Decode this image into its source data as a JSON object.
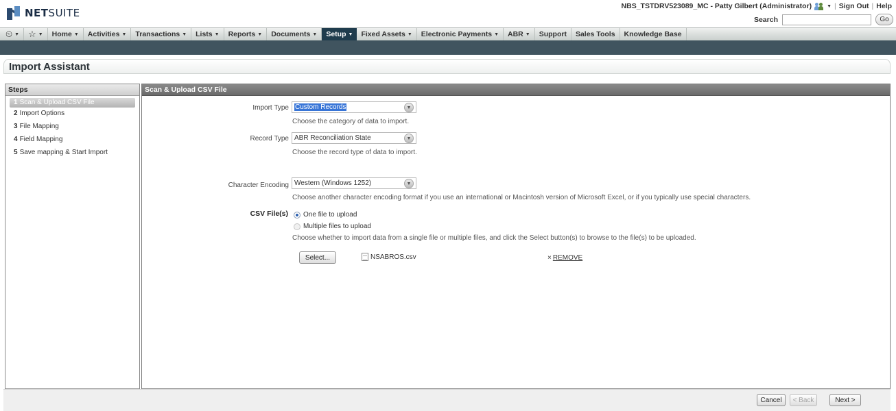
{
  "brand": {
    "prefix": "NET",
    "suffix": "SUITE"
  },
  "account": {
    "name": "NBS_TSTDRV523089_MC - Patty Gilbert (Administrator)",
    "signout": "Sign Out",
    "help": "Help",
    "search_label": "Search",
    "search_value": "",
    "go": "Go"
  },
  "nav": {
    "items": [
      {
        "label": "Home",
        "caret": true
      },
      {
        "label": "Activities",
        "caret": true
      },
      {
        "label": "Transactions",
        "caret": true
      },
      {
        "label": "Lists",
        "caret": true
      },
      {
        "label": "Reports",
        "caret": true
      },
      {
        "label": "Documents",
        "caret": true
      },
      {
        "label": "Setup",
        "caret": true,
        "active": true
      },
      {
        "label": "Fixed Assets",
        "caret": true
      },
      {
        "label": "Electronic Payments",
        "caret": true
      },
      {
        "label": "ABR",
        "caret": true
      },
      {
        "label": "Support",
        "caret": false
      },
      {
        "label": "Sales Tools",
        "caret": false
      },
      {
        "label": "Knowledge Base",
        "caret": false
      }
    ]
  },
  "page": {
    "title": "Import Assistant"
  },
  "steps": {
    "header": "Steps",
    "items": [
      {
        "num": "1",
        "label": "Scan & Upload CSV File"
      },
      {
        "num": "2",
        "label": "Import Options"
      },
      {
        "num": "3",
        "label": "File Mapping"
      },
      {
        "num": "4",
        "label": "Field Mapping"
      },
      {
        "num": "5",
        "label": "Save mapping & Start Import"
      }
    ]
  },
  "form": {
    "header": "Scan & Upload CSV File",
    "import_type": {
      "label": "Import Type",
      "value": "Custom Records",
      "help": "Choose the category of data to import."
    },
    "record_type": {
      "label": "Record Type",
      "value": "ABR Reconciliation State",
      "help": "Choose the record type of data to import."
    },
    "encoding": {
      "label": "Character Encoding",
      "value": "Western (Windows 1252)",
      "help": "Choose another character encoding format if you use an international or Macintosh version of Microsoft Excel, or if you typically use special characters."
    },
    "csv": {
      "label": "CSV File(s)",
      "option_one": "One file to upload",
      "option_multi": "Multiple files to upload",
      "help": "Choose whether to import data from a single file or multiple files, and click the Select button(s) to browse to the file(s) to be uploaded.",
      "select_label": "Select...",
      "file_name": "NSABROS.csv",
      "remove_label": "REMOVE"
    }
  },
  "footer": {
    "cancel": "Cancel",
    "back": "< Back",
    "next": "Next >"
  }
}
